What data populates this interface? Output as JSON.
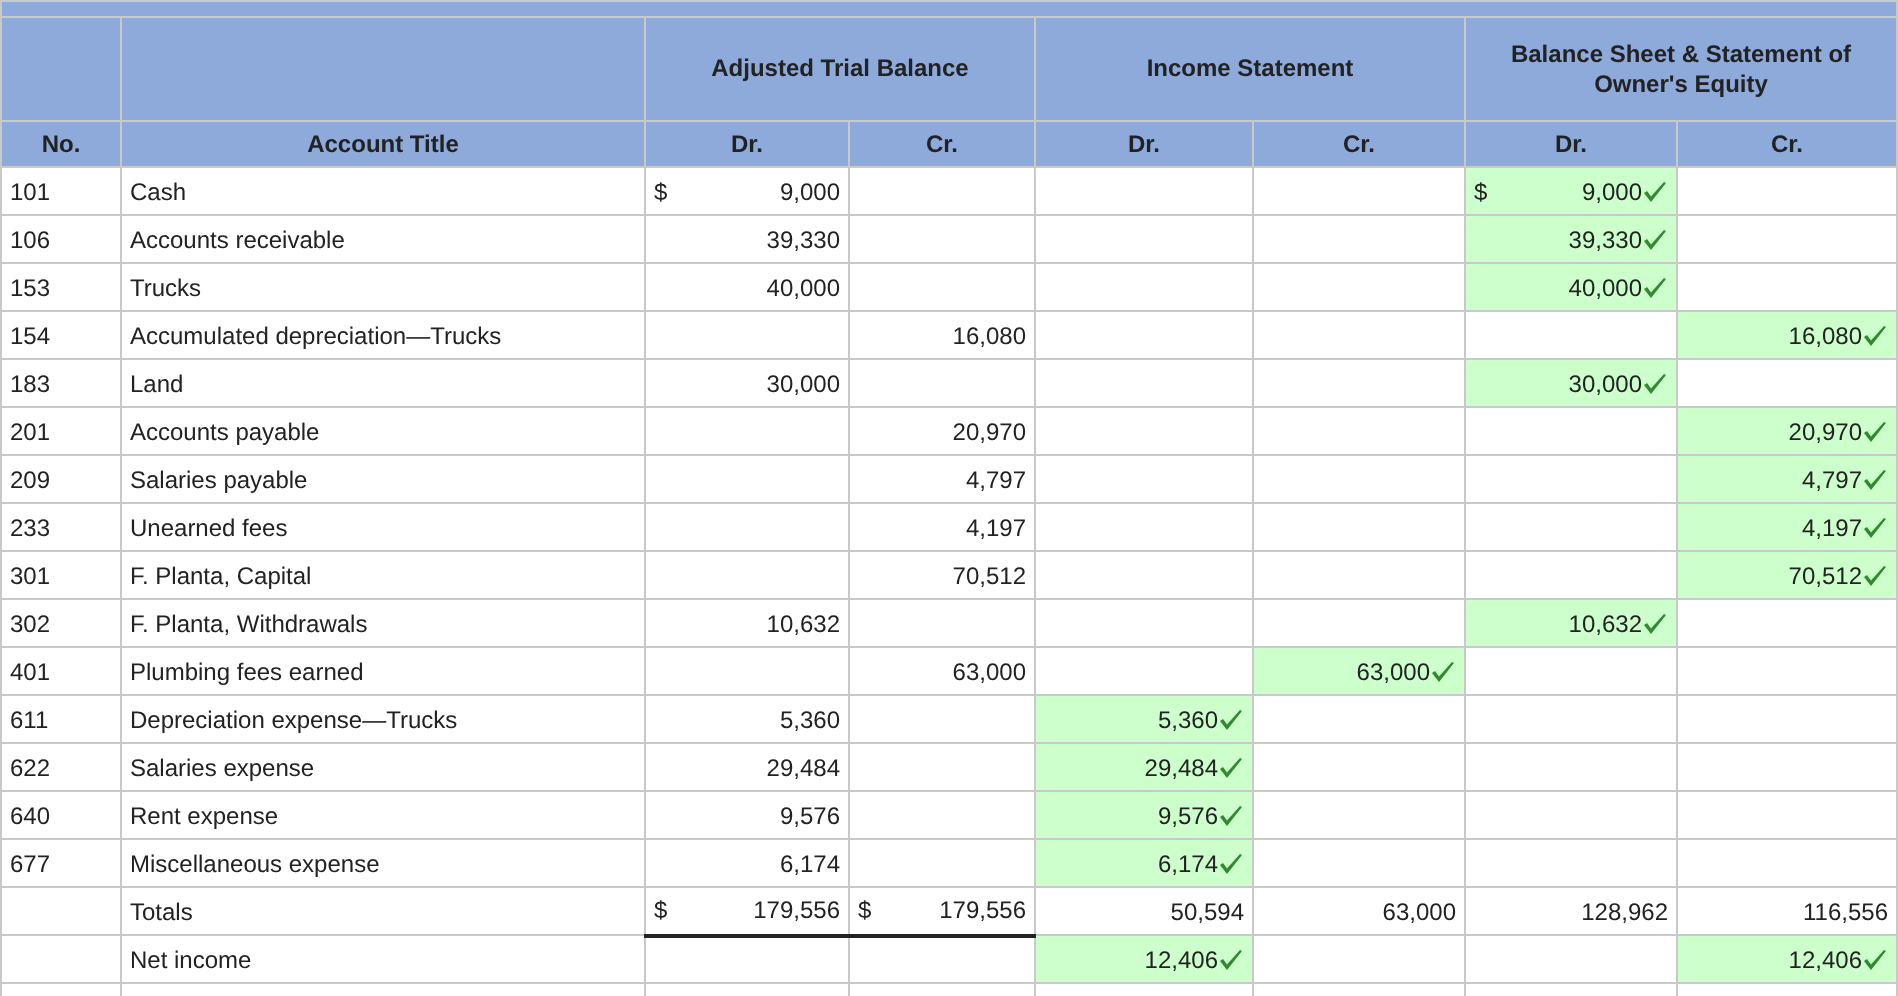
{
  "groups": [
    "Adjusted Trial Balance",
    "Income Statement",
    "Balance Sheet & Statement of Owner's Equity"
  ],
  "columns": [
    "No.",
    "Account Title",
    "Dr.",
    "Cr.",
    "Dr.",
    "Cr.",
    "Dr.",
    "Cr."
  ],
  "rows": [
    {
      "no": "101",
      "title": "Cash",
      "cells": [
        {
          "dollar": "$",
          "value": "9,000",
          "checked": false
        },
        null,
        null,
        null,
        {
          "dollar": "$",
          "value": "9,000",
          "checked": true
        },
        null
      ]
    },
    {
      "no": "106",
      "title": "Accounts receivable",
      "cells": [
        {
          "value": "39,330",
          "checked": false
        },
        null,
        null,
        null,
        {
          "value": "39,330",
          "checked": true
        },
        null
      ]
    },
    {
      "no": "153",
      "title": "Trucks",
      "cells": [
        {
          "value": "40,000",
          "checked": false
        },
        null,
        null,
        null,
        {
          "value": "40,000",
          "checked": true
        },
        null
      ]
    },
    {
      "no": "154",
      "title": "Accumulated depreciation—Trucks",
      "cells": [
        null,
        {
          "value": "16,080",
          "checked": false
        },
        null,
        null,
        null,
        {
          "value": "16,080",
          "checked": true
        }
      ]
    },
    {
      "no": "183",
      "title": "Land",
      "cells": [
        {
          "value": "30,000",
          "checked": false
        },
        null,
        null,
        null,
        {
          "value": "30,000",
          "checked": true
        },
        null
      ]
    },
    {
      "no": "201",
      "title": "Accounts payable",
      "cells": [
        null,
        {
          "value": "20,970",
          "checked": false
        },
        null,
        null,
        null,
        {
          "value": "20,970",
          "checked": true
        }
      ]
    },
    {
      "no": "209",
      "title": "Salaries payable",
      "cells": [
        null,
        {
          "value": "4,797",
          "checked": false
        },
        null,
        null,
        null,
        {
          "value": "4,797",
          "checked": true
        }
      ]
    },
    {
      "no": "233",
      "title": "Unearned fees",
      "cells": [
        null,
        {
          "value": "4,197",
          "checked": false
        },
        null,
        null,
        null,
        {
          "value": "4,197",
          "checked": true
        }
      ]
    },
    {
      "no": "301",
      "title": "F. Planta, Capital",
      "cells": [
        null,
        {
          "value": "70,512",
          "checked": false
        },
        null,
        null,
        null,
        {
          "value": "70,512",
          "checked": true
        }
      ]
    },
    {
      "no": "302",
      "title": "F. Planta, Withdrawals",
      "cells": [
        {
          "value": "10,632",
          "checked": false
        },
        null,
        null,
        null,
        {
          "value": "10,632",
          "checked": true
        },
        null
      ]
    },
    {
      "no": "401",
      "title": "Plumbing fees earned",
      "cells": [
        null,
        {
          "value": "63,000",
          "checked": false
        },
        null,
        {
          "value": "63,000",
          "checked": true
        },
        null,
        null
      ]
    },
    {
      "no": "611",
      "title": "Depreciation expense—Trucks",
      "cells": [
        {
          "value": "5,360",
          "checked": false
        },
        null,
        {
          "value": "5,360",
          "checked": true
        },
        null,
        null,
        null
      ]
    },
    {
      "no": "622",
      "title": "Salaries expense",
      "cells": [
        {
          "value": "29,484",
          "checked": false
        },
        null,
        {
          "value": "29,484",
          "checked": true
        },
        null,
        null,
        null
      ]
    },
    {
      "no": "640",
      "title": "Rent expense",
      "cells": [
        {
          "value": "9,576",
          "checked": false
        },
        null,
        {
          "value": "9,576",
          "checked": true
        },
        null,
        null,
        null
      ]
    },
    {
      "no": "677",
      "title": "Miscellaneous expense",
      "cells": [
        {
          "value": "6,174",
          "checked": false
        },
        null,
        {
          "value": "6,174",
          "checked": true
        },
        null,
        null,
        null
      ]
    },
    {
      "title": "Totals",
      "cells": [
        {
          "dollar": "$",
          "value": "179,556",
          "checked": false,
          "underlined": true
        },
        {
          "dollar": "$",
          "value": "179,556",
          "checked": false,
          "underlined": true
        },
        {
          "value": "50,594",
          "checked": false
        },
        {
          "value": "63,000",
          "checked": false
        },
        {
          "value": "128,962",
          "checked": false
        },
        {
          "value": "116,556",
          "checked": false
        }
      ]
    },
    {
      "title": "Net income",
      "cells": [
        null,
        null,
        {
          "value": "12,406",
          "checked": true
        },
        null,
        null,
        {
          "value": "12,406",
          "checked": true
        }
      ]
    }
  ]
}
